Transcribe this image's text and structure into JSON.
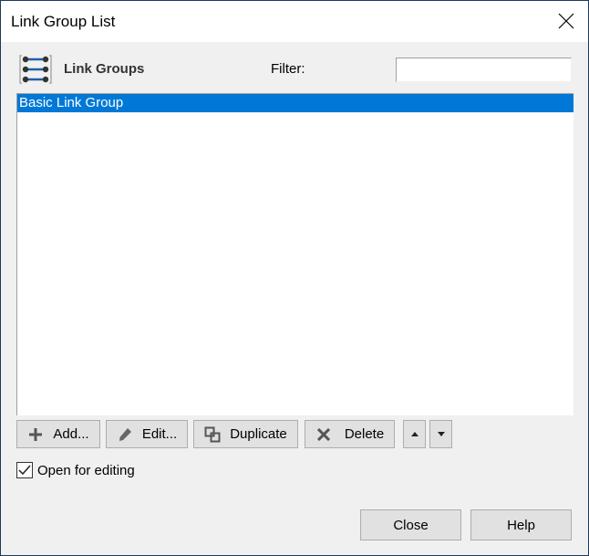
{
  "window": {
    "title": "Link Group List"
  },
  "header": {
    "section_label": "Link Groups",
    "filter_label": "Filter:",
    "filter_value": "",
    "filter_placeholder": ""
  },
  "list": {
    "items": [
      {
        "label": "Basic Link Group",
        "selected": true
      }
    ]
  },
  "toolbar": {
    "add_label": "Add...",
    "edit_label": "Edit...",
    "duplicate_label": "Duplicate",
    "delete_label": "Delete"
  },
  "options": {
    "open_for_editing_label": "Open for editing",
    "open_for_editing_checked": true
  },
  "footer": {
    "close_label": "Close",
    "help_label": "Help"
  },
  "colors": {
    "selection": "#0078d7",
    "icon_line": "#1f5fa8",
    "icon_dot": "#333333"
  }
}
